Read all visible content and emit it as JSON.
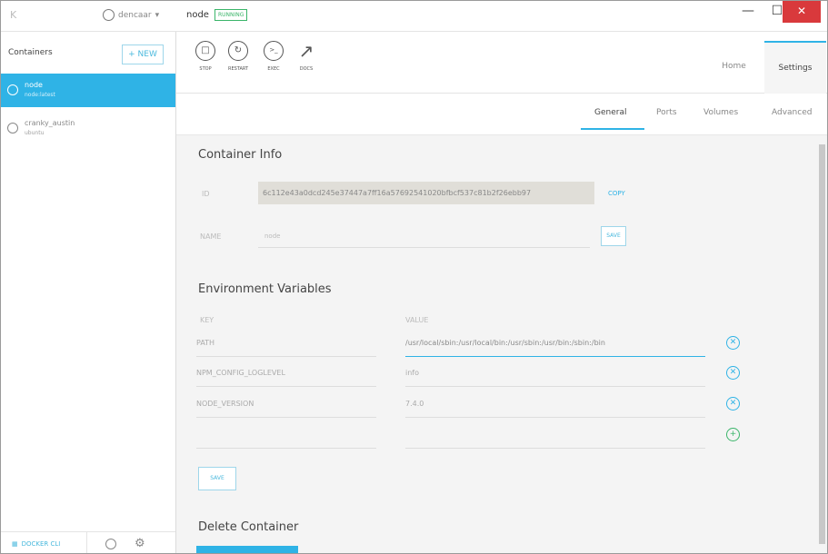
{
  "titlebar": {
    "app_logo": "K",
    "user": "dencaar",
    "user_caret": "▾",
    "container_name": "node",
    "status": "RUNNING",
    "minimize": "—",
    "maximize": "☐",
    "close": "✕"
  },
  "sidebar": {
    "title": "Containers",
    "new_button": "+ NEW",
    "containers": [
      {
        "name": "node",
        "image": "node:latest",
        "active": true
      },
      {
        "name": "cranky_austin",
        "image": "ubuntu",
        "active": false
      }
    ],
    "footer": {
      "docker_label": "DOCKER CLI"
    }
  },
  "toolbar": {
    "buttons": [
      {
        "label": "STOP",
        "icon": "stop-icon",
        "glyph": "□"
      },
      {
        "label": "RESTART",
        "icon": "restart-icon",
        "glyph": "↻"
      },
      {
        "label": "EXEC",
        "icon": "exec-icon",
        "glyph": ">_"
      },
      {
        "label": "DOCS",
        "icon": "external-link-icon",
        "glyph": "↗"
      }
    ],
    "tabs": {
      "home": "Home",
      "settings": "Settings"
    }
  },
  "subtabs": [
    "General",
    "Ports",
    "Volumes",
    "Advanced"
  ],
  "container_info": {
    "heading": "Container Info",
    "id_label": "ID",
    "id_value": "6c112e43a0dcd245e37447a7ff16a57692541020bfbcf537c81b2f26ebb97",
    "copy_label": "COPY",
    "name_label": "NAME",
    "name_value": "node",
    "save_label": "SAVE"
  },
  "env": {
    "heading": "Environment Variables",
    "key_header": "KEY",
    "value_header": "VALUE",
    "rows": [
      {
        "key": "PATH",
        "value": "/usr/local/sbin:/usr/local/bin:/usr/sbin:/usr/bin:/sbin:/bin"
      },
      {
        "key": "NPM_CONFIG_LOGLEVEL",
        "value": "info"
      },
      {
        "key": "NODE_VERSION",
        "value": "7.4.0"
      },
      {
        "key": "",
        "value": ""
      }
    ],
    "save_label": "SAVE"
  },
  "delete": {
    "heading": "Delete Container"
  },
  "colors": {
    "accent": "#2fb3e6",
    "running": "#3bb56a",
    "close": "#d9393c"
  }
}
